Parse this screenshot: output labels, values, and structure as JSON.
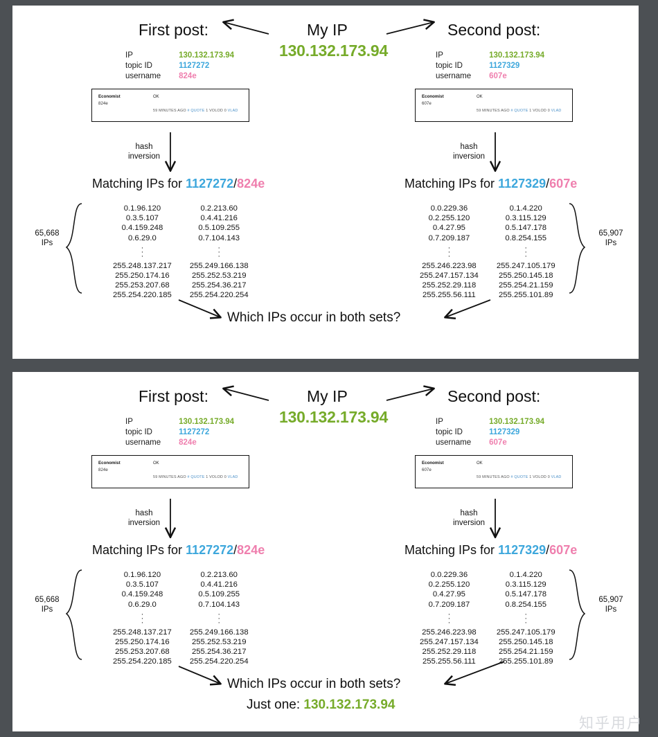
{
  "background_color": "#4c5054",
  "colors": {
    "green": "#76ab2a",
    "blue": "#3da7dc",
    "pink": "#ef7fae",
    "text": "#101010",
    "watermark": "#d8dade"
  },
  "watermark": "知乎用户",
  "myip": {
    "label": "My IP",
    "value": "130.132.173.94"
  },
  "left": {
    "heading": "First post:",
    "fields": [
      {
        "key": "IP",
        "value": "130.132.173.94",
        "color": "green"
      },
      {
        "key": "topic ID",
        "value": "1127272",
        "color": "blue"
      },
      {
        "key": "username",
        "value": "824e",
        "color": "pink"
      }
    ],
    "post": {
      "user": "Economist",
      "handle": "824e",
      "body": "OK",
      "meta_time": "59 MINUTES AGO",
      "meta_hash": "#",
      "meta_quote": "QUOTE",
      "meta_volod_count": "1",
      "meta_volod": "VOLOD",
      "meta_vlad_count": "0",
      "meta_vlad": "VLAD"
    },
    "arrow_label_line1": "hash",
    "arrow_label_line2": "inversion",
    "matching_prefix": "Matching IPs for ",
    "matching_topic": "1127272",
    "matching_slash": "/",
    "matching_user": "824e",
    "count_line1": "65,668",
    "count_line2": "IPs",
    "ips_col1": [
      "0.1.96.120",
      "0.3.5.107",
      "0.4.159.248",
      "0.6.29.0"
    ],
    "ips_col1_tail": [
      "255.248.137.217",
      "255.250.174.16",
      "255.253.207.68",
      "255.254.220.185"
    ],
    "ips_col2": [
      "0.2.213.60",
      "0.4.41.216",
      "0.5.109.255",
      "0.7.104.143"
    ],
    "ips_col2_tail": [
      "255.249.166.138",
      "255.252.53.219",
      "255.254.36.217",
      "255.254.220.254"
    ]
  },
  "right": {
    "heading": "Second post:",
    "fields": [
      {
        "key": "IP",
        "value": "130.132.173.94",
        "color": "green"
      },
      {
        "key": "topic ID",
        "value": "1127329",
        "color": "blue"
      },
      {
        "key": "username",
        "value": "607e",
        "color": "pink"
      }
    ],
    "post": {
      "user": "Economist",
      "handle": "607e",
      "body": "OK",
      "meta_time": "59 MINUTES AGO",
      "meta_hash": "#",
      "meta_quote": "QUOTE",
      "meta_volod_count": "1",
      "meta_volod": "VOLOD",
      "meta_vlad_count": "0",
      "meta_vlad": "VLAD"
    },
    "arrow_label_line1": "hash",
    "arrow_label_line2": "inversion",
    "matching_prefix": "Matching IPs for ",
    "matching_topic": "1127329",
    "matching_slash": "/",
    "matching_user": "607e",
    "count_line1": "65,907",
    "count_line2": "IPs",
    "ips_col1": [
      "0.0.229.36",
      "0.2.255.120",
      "0.4.27.95",
      "0.7.209.187"
    ],
    "ips_col1_tail": [
      "255.246.223.98",
      "255.247.157.134",
      "255.252.29.118",
      "255.255.56.111"
    ],
    "ips_col2": [
      "0.1.4.220",
      "0.3.115.129",
      "0.5.147.178",
      "0.8.254.155"
    ],
    "ips_col2_tail": [
      "255.247.105.179",
      "255.250.145.18",
      "255.254.21.159",
      "255.255.101.89"
    ]
  },
  "question": "Which IPs occur in both sets?",
  "answer_prefix": "Just one: ",
  "answer_value": "130.132.173.94"
}
